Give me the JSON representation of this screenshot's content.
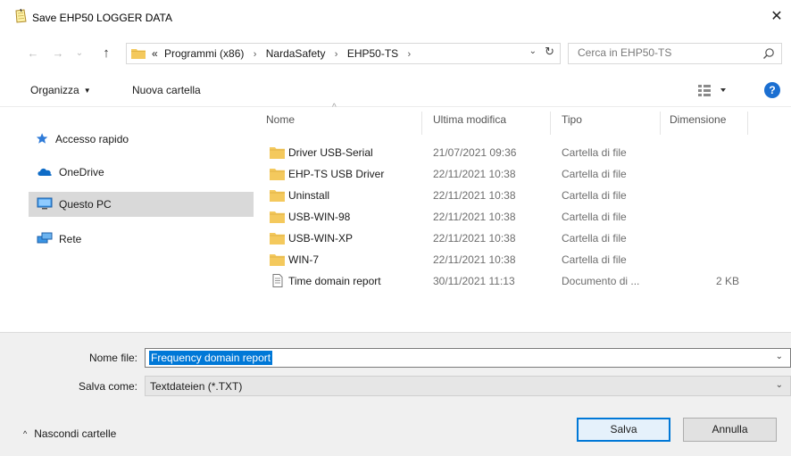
{
  "window": {
    "title": "Save EHP50 LOGGER DATA",
    "close_glyph": "✕"
  },
  "nav": {
    "back_glyph": "←",
    "forward_glyph": "→",
    "recent_glyph": "⌄",
    "up_glyph": "↑",
    "breadcrumb": {
      "overflow": "«",
      "items": [
        "Programmi (x86)",
        "NardaSafety",
        "EHP50-TS"
      ],
      "separator": "›"
    },
    "dropdown_glyph": "⌄",
    "refresh_glyph": "↻",
    "search_placeholder": "Cerca in EHP50-TS"
  },
  "toolbar": {
    "organize_label": "Organizza",
    "organize_caret": "▼",
    "new_folder_label": "Nuova cartella",
    "help_label": "?"
  },
  "sidebar": {
    "items": [
      {
        "label": "Accesso rapido",
        "icon": "star-icon"
      },
      {
        "label": "OneDrive",
        "icon": "cloud-icon"
      },
      {
        "label": "Questo PC",
        "icon": "computer-icon",
        "selected": true
      },
      {
        "label": "Rete",
        "icon": "network-icon"
      }
    ]
  },
  "filelist": {
    "sort_caret": "^",
    "columns": {
      "name": "Nome",
      "modified": "Ultima modifica",
      "type": "Tipo",
      "size": "Dimensione"
    },
    "rows": [
      {
        "name": "Driver USB-Serial",
        "modified": "21/07/2021 09:36",
        "type": "Cartella di file",
        "size": "",
        "icon": "folder-icon"
      },
      {
        "name": "EHP-TS USB Driver",
        "modified": "22/11/2021 10:38",
        "type": "Cartella di file",
        "size": "",
        "icon": "folder-icon"
      },
      {
        "name": "Uninstall",
        "modified": "22/11/2021 10:38",
        "type": "Cartella di file",
        "size": "",
        "icon": "folder-icon"
      },
      {
        "name": "USB-WIN-98",
        "modified": "22/11/2021 10:38",
        "type": "Cartella di file",
        "size": "",
        "icon": "folder-icon"
      },
      {
        "name": "USB-WIN-XP",
        "modified": "22/11/2021 10:38",
        "type": "Cartella di file",
        "size": "",
        "icon": "folder-icon"
      },
      {
        "name": "WIN-7",
        "modified": "22/11/2021 10:38",
        "type": "Cartella di file",
        "size": "",
        "icon": "folder-icon"
      },
      {
        "name": "Time domain report",
        "modified": "30/11/2021 11:13",
        "type": "Documento di ...",
        "size": "2 KB",
        "icon": "document-icon"
      }
    ]
  },
  "form": {
    "filename_label": "Nome file:",
    "filename_value": "Frequency domain report",
    "savetype_label": "Salva come:",
    "savetype_value": "Textdateien (*.TXT)",
    "dropdown_glyph": "⌄"
  },
  "footer": {
    "hide_folders_glyph": "^",
    "hide_folders_label": "Nascondi cartelle",
    "save_label": "Salva",
    "cancel_label": "Annulla"
  },
  "colors": {
    "accent": "#0078d7",
    "folder": "#f4c95d",
    "help": "#1b6fd1",
    "selected_nav": "#d9d9d9"
  }
}
